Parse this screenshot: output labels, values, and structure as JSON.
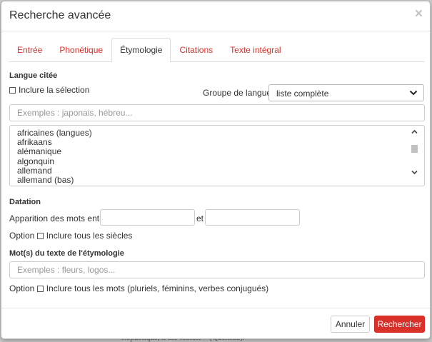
{
  "backdrop": {
    "text": "République, il me semble » (Queneau)."
  },
  "modal": {
    "title": "Recherche avancée",
    "close_symbol": "×"
  },
  "tabs": [
    {
      "label": "Entrée",
      "active": false
    },
    {
      "label": "Phonétique",
      "active": false
    },
    {
      "label": "Étymologie",
      "active": true
    },
    {
      "label": "Citations",
      "active": false
    },
    {
      "label": "Texte intégral",
      "active": false
    }
  ],
  "langue": {
    "section_title": "Langue citée",
    "include_selection_label": "Inclure la sélection",
    "group_label": "Groupe de langues",
    "group_selected": "liste complète",
    "search_placeholder": "Exemples : japonais, hébreu...",
    "options": [
      "africaines (langues)",
      "afrikaans",
      "alémanique",
      "algonquin",
      "allemand",
      "allemand (bas)"
    ]
  },
  "datation": {
    "section_title": "Datation",
    "apparition_label": "Apparition des mots entre",
    "et_label": "et",
    "option_label": "Option",
    "all_centuries_label": "Inclure tous les siècles"
  },
  "mots": {
    "section_title": "Mot(s) du texte de l'étymologie",
    "placeholder": "Exemples : fleurs, logos...",
    "option_label": "Option",
    "all_words_label": "Inclure tous les mots (pluriels, féminins, verbes conjugués)"
  },
  "footer": {
    "cancel_label": "Annuler",
    "search_label": "Rechercher"
  },
  "colors": {
    "accent": "#d9302a"
  }
}
